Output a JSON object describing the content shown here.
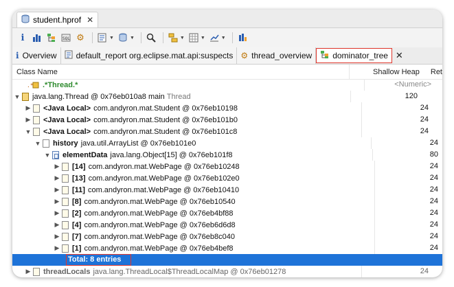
{
  "file_tab": {
    "title": "student.hprof",
    "close": "✕"
  },
  "toolbar_icons": [
    "info-icon",
    "histogram-icon",
    "dominator-icon",
    "sql-icon",
    "gear-icon",
    "report-icon",
    "database-icon",
    "search-icon",
    "group-icon",
    "calculate-icon",
    "export-icon",
    "pin-icon"
  ],
  "tabs": [
    {
      "label": "Overview"
    },
    {
      "label": "default_report  org.eclipse.mat.api:suspects"
    },
    {
      "label": "thread_overview"
    },
    {
      "label": "dominator_tree"
    }
  ],
  "tab_close": "✕",
  "columns": {
    "class_name": "Class Name",
    "shallow_heap": "Shallow Heap",
    "retained": "Ret"
  },
  "filter_row": {
    "class_filter": ".*Thread.*",
    "heap_filter": "<Numeric>"
  },
  "rows": [
    {
      "prefix": "",
      "name": "java.lang.Thread @ 0x76eb010a8  main",
      "suffix": "Thread",
      "heap": "120"
    },
    {
      "prefix": "<Java Local>",
      "name": "com.andyron.mat.Student @ 0x76eb10198",
      "suffix": "",
      "heap": "24"
    },
    {
      "prefix": "<Java Local>",
      "name": "com.andyron.mat.Student @ 0x76eb101b0",
      "suffix": "",
      "heap": "24"
    },
    {
      "prefix": "<Java Local>",
      "name": "com.andyron.mat.Student @ 0x76eb101c8",
      "suffix": "",
      "heap": "24"
    },
    {
      "prefix": "history",
      "name": "java.util.ArrayList @ 0x76eb101e0",
      "suffix": "",
      "heap": "24"
    },
    {
      "prefix": "elementData",
      "name": "java.lang.Object[15] @ 0x76eb101f8",
      "suffix": "",
      "heap": "80"
    },
    {
      "prefix": "[14]",
      "name": "com.andyron.mat.WebPage @ 0x76eb10248",
      "suffix": "",
      "heap": "24"
    },
    {
      "prefix": "[13]",
      "name": "com.andyron.mat.WebPage @ 0x76eb102e0",
      "suffix": "",
      "heap": "24"
    },
    {
      "prefix": "[11]",
      "name": "com.andyron.mat.WebPage @ 0x76eb10410",
      "suffix": "",
      "heap": "24"
    },
    {
      "prefix": "[8]",
      "name": "com.andyron.mat.WebPage @ 0x76eb10540",
      "suffix": "",
      "heap": "24"
    },
    {
      "prefix": "[2]",
      "name": "com.andyron.mat.WebPage @ 0x76eb4bf88",
      "suffix": "",
      "heap": "24"
    },
    {
      "prefix": "[4]",
      "name": "com.andyron.mat.WebPage @ 0x76eb6d6d8",
      "suffix": "",
      "heap": "24"
    },
    {
      "prefix": "[7]",
      "name": "com.andyron.mat.WebPage @ 0x76eb8c040",
      "suffix": "",
      "heap": "24"
    },
    {
      "prefix": "[1]",
      "name": "com.andyron.mat.WebPage @ 0x76eb4bef8",
      "suffix": "",
      "heap": "24"
    },
    {
      "prefix": "",
      "name": "Total: 8 entries",
      "suffix": "",
      "heap": ""
    },
    {
      "prefix": "threadLocals",
      "name": "java.lang.ThreadLocal$ThreadLocalMap @ 0x76eb01278",
      "suffix": "",
      "heap": "24"
    }
  ]
}
